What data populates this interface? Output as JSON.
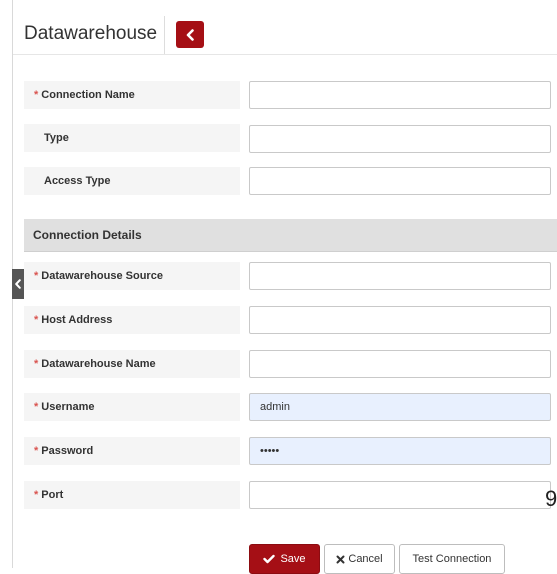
{
  "header": {
    "title": "Datawarehouse",
    "back_icon": "chevron-left-icon"
  },
  "connection": {
    "name_label": "Connection Name",
    "type_label": "Type",
    "access_type_label": "Access Type",
    "name_value": "",
    "type_value": "",
    "access_type_value": ""
  },
  "section": {
    "title": "Connection Details"
  },
  "details": {
    "source_label": "Datawarehouse Source",
    "host_label": "Host Address",
    "dw_name_label": "Datawarehouse Name",
    "username_label": "Username",
    "password_label": "Password",
    "port_label": "Port",
    "source_value": "",
    "host_value": "",
    "dw_name_value": "",
    "username_value": "admin",
    "password_value": "admin",
    "port_value": ""
  },
  "required_marker": "*",
  "stray_glyph": "9",
  "buttons": {
    "save_label": "Save",
    "cancel_label": "Cancel",
    "test_label": "Test Connection"
  },
  "colors": {
    "accent": "#a50f15",
    "required": "#d9534f",
    "autofill": "#e8f0fe"
  }
}
